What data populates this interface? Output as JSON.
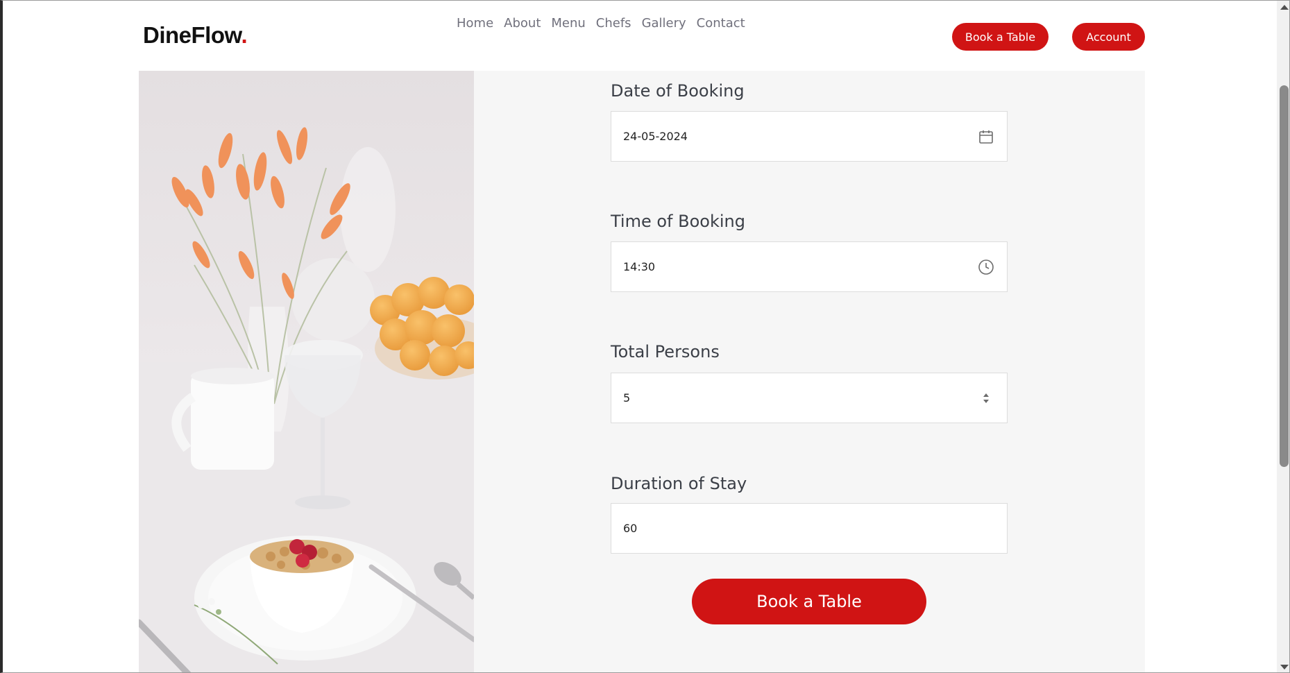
{
  "brand": {
    "name": "DineFlow",
    "dot": ".",
    "accent": "#d01414"
  },
  "nav": [
    "Home",
    "About",
    "Menu",
    "Chefs",
    "Gallery",
    "Contact"
  ],
  "header_buttons": {
    "book": "Book a Table",
    "account": "Account"
  },
  "form": {
    "date": {
      "label": "Date of Booking",
      "value": "24-05-2024",
      "icon": "calendar-icon"
    },
    "time": {
      "label": "Time of Booking",
      "value": "14:30",
      "icon": "clock-icon"
    },
    "persons": {
      "label": "Total Persons",
      "value": "5",
      "icon": "spinner-arrows-icon"
    },
    "duration": {
      "label": "Duration of Stay",
      "value": "60"
    },
    "submit": "Book a Table"
  }
}
